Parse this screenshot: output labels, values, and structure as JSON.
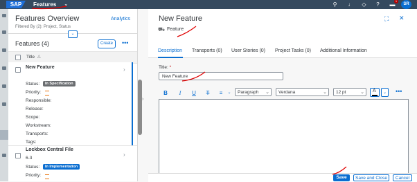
{
  "shell": {
    "logo": "SAP",
    "app_title": "Features",
    "avatar_initials": "SR",
    "notification_count": "1",
    "icons": [
      "search-icon",
      "bell-icon",
      "help-icon",
      "notifications-icon"
    ]
  },
  "master": {
    "title": "Features Overview",
    "analytics_link": "Analytics",
    "filter_text": "Filtered By (2): Project, Status",
    "list_title": "Features (4)",
    "create_label": "Create",
    "column_title": "Title",
    "labels": {
      "status": "Status:",
      "priority": "Priority:",
      "responsible": "Responsible:",
      "release": "Release:",
      "scope": "Scope:",
      "workstream": "Workstream:",
      "transports": "Transports:",
      "tags": "Tags:"
    },
    "items": [
      {
        "title": "New Feature",
        "status": "In Specification",
        "status_color": "#6a6d70"
      },
      {
        "title": "Lockbox Central File",
        "subtitle": "6-3",
        "status": "In Implementation",
        "status_color": "#0a6ed1"
      }
    ]
  },
  "detail": {
    "title": "New Feature",
    "type_label": "Feature",
    "tabs": [
      "Description",
      "Transports (0)",
      "User Stories (0)",
      "Project Tasks (0)",
      "Additional Information"
    ],
    "title_field_label": "Title:",
    "title_field_required": "*",
    "title_field_value": "New Feature",
    "toolbar": {
      "paragraph": "Paragraph",
      "font": "Verdana",
      "size": "12 pt"
    },
    "footer": {
      "save": "Save",
      "save_close": "Save and Close",
      "cancel": "Cancel"
    }
  },
  "colors": {
    "accent": "#0a6ed1",
    "shell": "#354a5f",
    "annotation": "#e00000"
  }
}
